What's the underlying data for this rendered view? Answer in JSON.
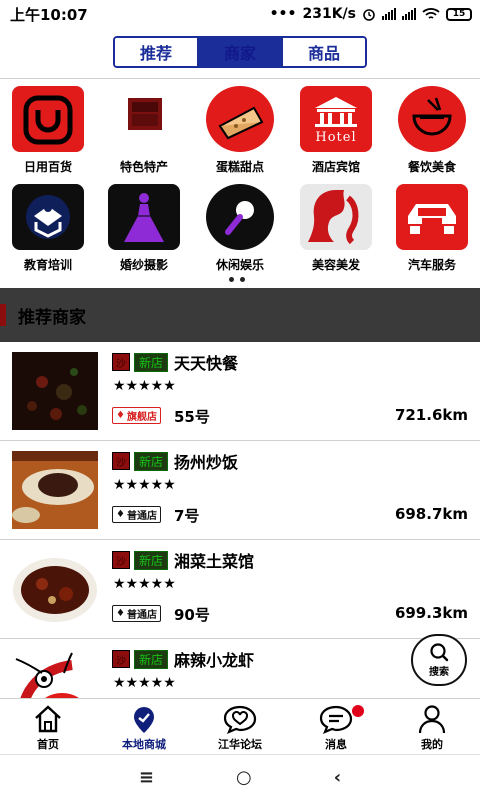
{
  "status_bar": {
    "time": "上午10:07",
    "dots": "•••",
    "speed": "231K/s",
    "battery": "15"
  },
  "top_tabs": [
    {
      "label": "推荐",
      "active": false
    },
    {
      "label": "商家",
      "active": true
    },
    {
      "label": "商品",
      "active": false
    }
  ],
  "categories": [
    {
      "label": "日用百货",
      "icon": "smile-bag-icon"
    },
    {
      "label": "特色特产",
      "icon": "gift-box-icon"
    },
    {
      "label": "蛋糕甜点",
      "icon": "cake-icon"
    },
    {
      "label": "酒店宾馆",
      "icon": "hotel-icon",
      "icon_text": "Hotel"
    },
    {
      "label": "餐饮美食",
      "icon": "bowl-icon"
    },
    {
      "label": "教育培训",
      "icon": "education-icon"
    },
    {
      "label": "婚纱摄影",
      "icon": "wedding-dress-icon"
    },
    {
      "label": "休闲娱乐",
      "icon": "microphone-icon"
    },
    {
      "label": "美容美发",
      "icon": "beauty-icon"
    },
    {
      "label": "汽车服务",
      "icon": "car-icon"
    }
  ],
  "section": {
    "title": "推荐商家"
  },
  "merchants": [
    {
      "badge_sha": "沙",
      "badge_new": "新店",
      "name": "天天快餐",
      "stars": "★★★★★",
      "level": "旗舰店",
      "level_type": "flagship",
      "number": "55号",
      "distance": "721.6km"
    },
    {
      "badge_sha": "沙",
      "badge_new": "新店",
      "name": "扬州炒饭",
      "stars": "★★★★★",
      "level": "普通店",
      "level_type": "normal",
      "number": "7号",
      "distance": "698.7km"
    },
    {
      "badge_sha": "沙",
      "badge_new": "新店",
      "name": "湘菜土菜馆",
      "stars": "★★★★★",
      "level": "普通店",
      "level_type": "normal",
      "number": "90号",
      "distance": "699.3km"
    },
    {
      "badge_sha": "沙",
      "badge_new": "新店",
      "name": "麻辣小龙虾",
      "stars": "★★★★★",
      "level": "",
      "level_type": "",
      "number": "",
      "distance": ""
    }
  ],
  "fab": {
    "label": "搜索"
  },
  "bottom_tabs": [
    {
      "label": "首页",
      "icon": "home-icon",
      "active": false
    },
    {
      "label": "本地商城",
      "icon": "location-pin-icon",
      "active": true
    },
    {
      "label": "江华论坛",
      "icon": "heart-chat-icon",
      "active": false
    },
    {
      "label": "消息",
      "icon": "message-icon",
      "active": false,
      "has_dot": true
    },
    {
      "label": "我的",
      "icon": "user-icon",
      "active": false
    }
  ],
  "system_nav": {
    "menu": "≡",
    "home": "○",
    "back": "‹"
  },
  "colors": {
    "accent": "#1a2d99",
    "section_bg": "#3a3a3a",
    "section_mark": "#8c0d0d",
    "flagship": "#d82020",
    "new_badge": "#17c117"
  }
}
